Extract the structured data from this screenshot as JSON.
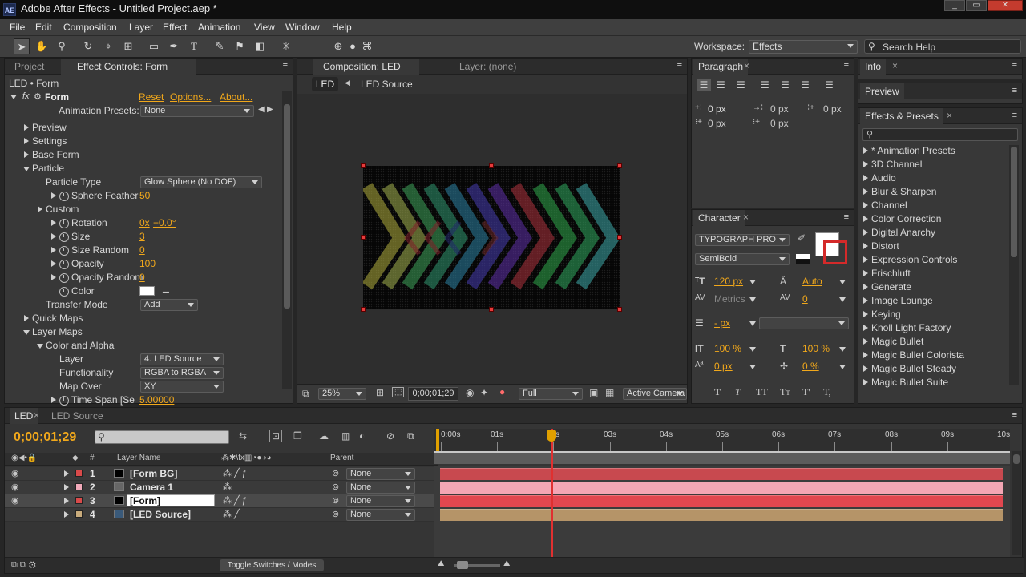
{
  "app": {
    "title": "Adobe After Effects - Untitled Project.aep *",
    "badge": "AE",
    "win_controls": [
      "_",
      "▭",
      "✕"
    ]
  },
  "menu": [
    "File",
    "Edit",
    "Composition",
    "Layer",
    "Effect",
    "Animation",
    "View",
    "Window",
    "Help"
  ],
  "toolbar": {
    "workspace_label": "Workspace:",
    "workspace_value": "Effects",
    "search_placeholder": "Search Help"
  },
  "project_tab": "Project",
  "effect_controls": {
    "tab": "Effect Controls: Form",
    "header": "LED • Form",
    "fx_name": "Form",
    "reset": "Reset",
    "options": "Options...",
    "about": "About...",
    "presets_label": "Animation Presets:",
    "presets_value": "None",
    "rows": [
      {
        "label": "Preview",
        "indent": 0,
        "twirl": "r"
      },
      {
        "label": "Settings",
        "indent": 0,
        "twirl": "r"
      },
      {
        "label": "Base Form",
        "indent": 0,
        "twirl": "r"
      },
      {
        "label": "Particle",
        "indent": 0,
        "twirl": "d"
      },
      {
        "label": "Particle Type",
        "indent": 1,
        "dropdown": "Glow Sphere (No DOF)"
      },
      {
        "label": "Sphere Feather",
        "indent": 2,
        "twirl": "r",
        "stop": true,
        "value": "50"
      },
      {
        "label": "Custom",
        "indent": 1,
        "twirl": "r"
      },
      {
        "label": "Rotation",
        "indent": 2,
        "twirl": "r",
        "stop": true,
        "value": "0x",
        "value2": "+0.0°"
      },
      {
        "label": "Size",
        "indent": 2,
        "twirl": "r",
        "stop": true,
        "value": "3"
      },
      {
        "label": "Size Random",
        "indent": 2,
        "twirl": "r",
        "stop": true,
        "value": "0"
      },
      {
        "label": "Opacity",
        "indent": 2,
        "twirl": "r",
        "stop": true,
        "value": "100"
      },
      {
        "label": "Opacity Random",
        "indent": 2,
        "twirl": "r",
        "stop": true,
        "value": "0"
      },
      {
        "label": "Color",
        "indent": 2,
        "stop": true,
        "swatch": true
      },
      {
        "label": "Transfer Mode",
        "indent": 1,
        "dropdown": "Add"
      },
      {
        "label": "Quick Maps",
        "indent": 0,
        "twirl": "r"
      },
      {
        "label": "Layer Maps",
        "indent": 0,
        "twirl": "d"
      },
      {
        "label": "Color and Alpha",
        "indent": 1,
        "twirl": "d"
      },
      {
        "label": "Layer",
        "indent": 2,
        "dropdown": "4. LED Source"
      },
      {
        "label": "Functionality",
        "indent": 2,
        "dropdown": "RGBA to RGBA"
      },
      {
        "label": "Map Over",
        "indent": 2,
        "dropdown": "XY"
      },
      {
        "label": "Time Span [Se",
        "indent": 2,
        "twirl": "r",
        "stop": true,
        "value": "5.00000"
      }
    ]
  },
  "composition": {
    "tab": "Composition: LED",
    "layer_tab": "Layer: (none)",
    "crumb_active": "LED",
    "crumb_next": "LED Source",
    "zoom": "25%",
    "timecode": "0;00;01;29",
    "resolution": "Full",
    "camera": "Active Camera"
  },
  "paragraph": {
    "tab": "Paragraph",
    "values": [
      "0 px",
      "0 px",
      "0 px",
      "0 px",
      "0 px"
    ]
  },
  "character": {
    "tab": "Character",
    "font": "TYPOGRAPH PRO",
    "style": "SemiBold",
    "size": "120 px",
    "leading": "Auto",
    "tracking_label": "Metrics",
    "tracking": "0",
    "stroke": "- px",
    "vscale": "100 %",
    "hscale": "100 %",
    "baseline": "0 px",
    "tsume": "0 %",
    "styles": [
      "T",
      "T",
      "TT",
      "Tт",
      "T'",
      "T,"
    ]
  },
  "info_tab": "Info",
  "preview_tab": "Preview",
  "effects_presets": {
    "tab": "Effects & Presets",
    "items": [
      "* Animation Presets",
      "3D Channel",
      "Audio",
      "Blur & Sharpen",
      "Channel",
      "Color Correction",
      "Digital Anarchy",
      "Distort",
      "Expression Controls",
      "Frischluft",
      "Generate",
      "Image Lounge",
      "Keying",
      "Knoll Light Factory",
      "Magic Bullet",
      "Magic Bullet Colorista",
      "Magic Bullet Steady",
      "Magic Bullet Suite"
    ]
  },
  "timeline": {
    "tabs": [
      "LED",
      "LED Source"
    ],
    "timecode": "0;00;01;29",
    "ruler": [
      "0:00s",
      "01s",
      "02s",
      "03s",
      "04s",
      "05s",
      "06s",
      "07s",
      "08s",
      "09s",
      "10s"
    ],
    "playhead_s": 1.97,
    "col_layer_name": "Layer Name",
    "col_parent": "Parent",
    "toggle_label": "Toggle Switches / Modes",
    "layers": [
      {
        "num": "1",
        "name": "[Form BG]",
        "label_color": "#d94a4a",
        "bar_color": "#c8494f",
        "parent": "None"
      },
      {
        "num": "2",
        "name": "Camera 1",
        "label_color": "#f1a9b9",
        "bar_color": "#f4a6b4",
        "parent": "None"
      },
      {
        "num": "3",
        "name": "[Form]",
        "label_color": "#d94a4a",
        "bar_color": "#e2474f",
        "parent": "None",
        "selected": true
      },
      {
        "num": "4",
        "name": "[LED Source]",
        "label_color": "#c8ab7c",
        "bar_color": "#b59468",
        "parent": "None"
      }
    ]
  }
}
